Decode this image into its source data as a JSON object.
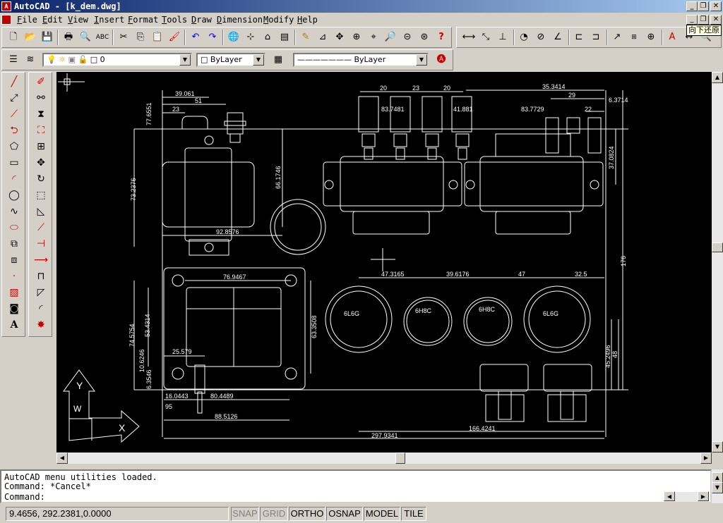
{
  "window": {
    "title": "AutoCAD - [k_dem.dwg]",
    "app_icon": "A"
  },
  "menu": [
    "File",
    "Edit",
    "View",
    "Insert",
    "Format",
    "Tools",
    "Draw",
    "Dimension",
    "Modify",
    "Help"
  ],
  "tooltip": "向下还原",
  "layer": {
    "current": "0",
    "color": "ByLayer",
    "linetype": "ByLayer"
  },
  "drawing": {
    "dims": [
      "39.061",
      "51",
      "23",
      "77.6551",
      "20",
      "23",
      "20",
      "35.3414",
      "83.7481",
      "41.881",
      "83.7729",
      "29",
      "22",
      "6.3714",
      "66.1746",
      "73.2376",
      "92.8576",
      "37.0824",
      "176",
      "76.9467",
      "47.3165",
      "39.6176",
      "47",
      "32.5",
      "53.4314",
      "74.5754",
      "63.3508",
      "25.579",
      "10.6246",
      "6.3546",
      "16.0443",
      "80.4489",
      "95",
      "88.5126",
      "45.2496",
      "48",
      "166.4241",
      "297.9341"
    ],
    "tube_labels": [
      "6L6G",
      "6H8C",
      "6H8C",
      "6L6G"
    ],
    "ucs": {
      "x": "X",
      "y": "Y",
      "w": "W"
    }
  },
  "command": {
    "lines": [
      "AutoCAD menu utilities loaded.",
      "Command: *Cancel*",
      "Command:"
    ]
  },
  "status": {
    "coords": "9.4656, 292.2381,0.0000",
    "snap": "SNAP",
    "grid": "GRID",
    "ortho": "ORTHO",
    "osnap": "OSNAP",
    "model": "MODEL",
    "tile": "TILE"
  }
}
